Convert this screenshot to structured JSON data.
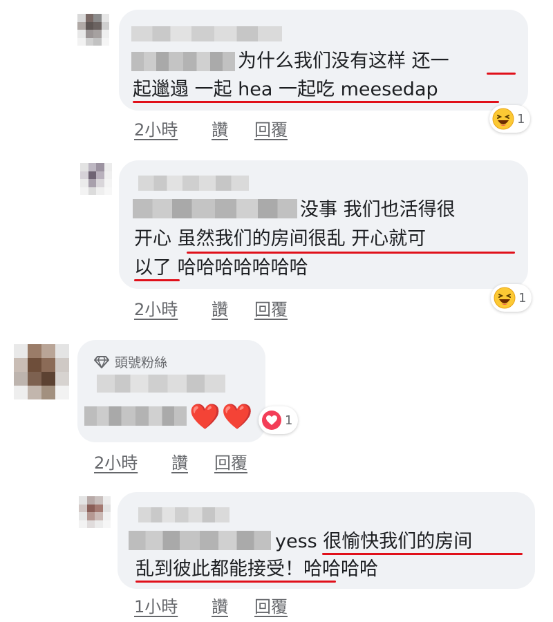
{
  "comments": [
    {
      "text_lines": [
        "为什么我们没有这样 还一",
        "起邋遢 一起 hea 一起吃 meesedap"
      ],
      "reaction": {
        "icon": "laughing-emoji-icon",
        "count": "1"
      },
      "meta": {
        "time": "2小時",
        "like": "讚",
        "reply": "回覆"
      }
    },
    {
      "text_lines": [
        "没事 我们也活得很",
        "开心 虽然我们的房间很乱 开心就可",
        "以了 哈哈哈哈哈哈哈"
      ],
      "reaction": {
        "icon": "laughing-emoji-icon",
        "count": "1"
      },
      "meta": {
        "time": "2小時",
        "like": "讚",
        "reply": "回覆"
      }
    },
    {
      "badge": "頭號粉絲",
      "text_lines": [
        "❤️❤️"
      ],
      "reaction": {
        "icon": "love-reaction-icon",
        "count": "1"
      },
      "meta": {
        "time": "2小時",
        "like": "讚",
        "reply": "回覆"
      }
    },
    {
      "text_lines": [
        "yess 很愉快我们的房间",
        "乱到彼此都能接受！哈哈哈哈"
      ],
      "meta": {
        "time": "1小時",
        "like": "讚",
        "reply": "回覆"
      }
    }
  ],
  "colors": {
    "underline": "#e0101a",
    "bubble": "#f0f2f5",
    "meta": "#65676b",
    "heart": "#e41e2d"
  }
}
